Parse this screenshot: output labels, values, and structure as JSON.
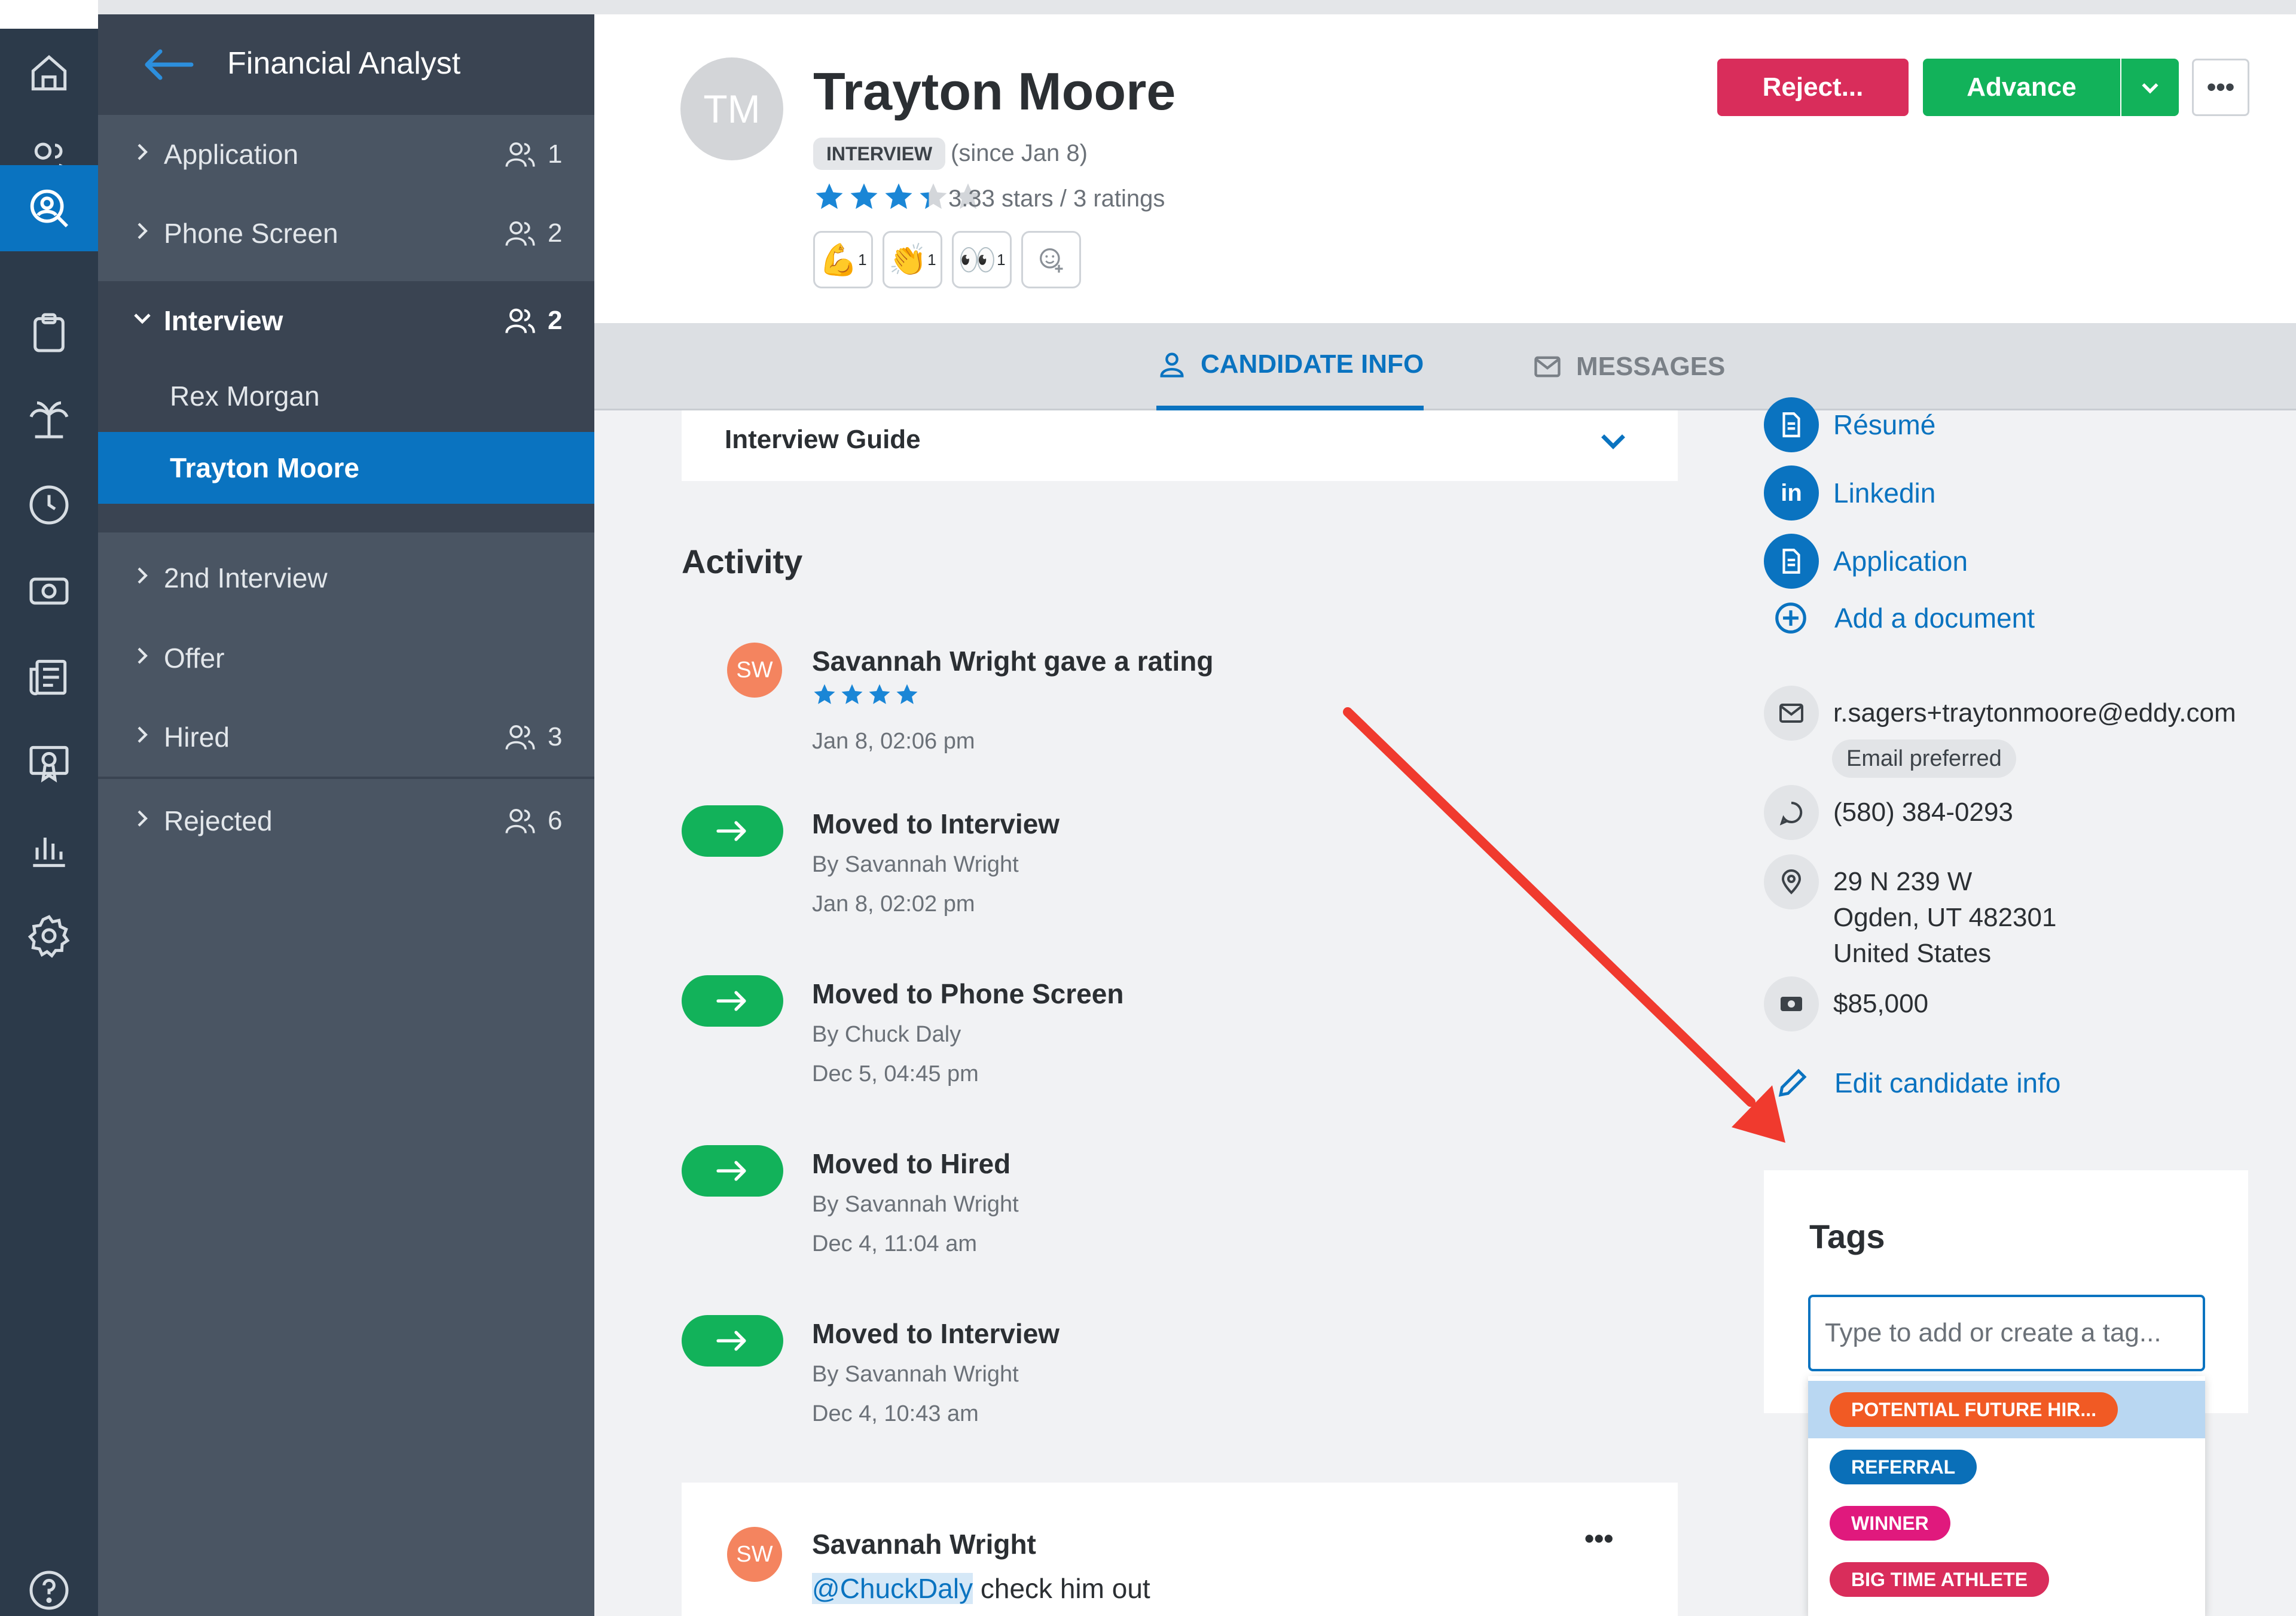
{
  "sidebar": {
    "job_title": "Financial Analyst",
    "stages": [
      {
        "label": "Application",
        "count": "1"
      },
      {
        "label": "Phone Screen",
        "count": "2"
      },
      {
        "label": "Interview",
        "count": "2"
      },
      {
        "label": "2nd Interview",
        "count": ""
      },
      {
        "label": "Offer",
        "count": ""
      },
      {
        "label": "Hired",
        "count": "3"
      },
      {
        "label": "Rejected",
        "count": "6"
      }
    ],
    "interview_candidates": [
      "Rex Morgan",
      "Trayton Moore"
    ]
  },
  "rail": {
    "icons": [
      "home-icon",
      "people-icon",
      "candidate-search-icon",
      "clipboard-icon",
      "palm-tree-icon",
      "clock-icon",
      "money-icon",
      "newspaper-icon",
      "award-icon",
      "bar-chart-icon",
      "gear-icon",
      "help-icon"
    ]
  },
  "candidate": {
    "initials": "TM",
    "name": "Trayton Moore",
    "stage_badge": "INTERVIEW",
    "since": "(since Jan 8)",
    "rating_stars": 3.33,
    "ratings_text": "3.33 stars / 3 ratings",
    "reactions": [
      {
        "emoji": "💪",
        "count": "1"
      },
      {
        "emoji": "👏",
        "count": "1"
      },
      {
        "emoji": "👀",
        "count": "1"
      },
      {
        "emoji": "☺",
        "count": ""
      }
    ]
  },
  "actions": {
    "reject": "Reject...",
    "advance": "Advance",
    "more": "•••"
  },
  "tabs": {
    "candidate_info": "CANDIDATE INFO",
    "messages": "MESSAGES"
  },
  "main": {
    "interview_guide": "Interview Guide",
    "activity_title": "Activity",
    "activities": [
      {
        "type": "rating",
        "initials": "SW",
        "title": "Savannah Wright gave a rating",
        "stars": 4,
        "when": "Jan 8, 02:06 pm"
      },
      {
        "type": "move",
        "title": "Moved to Interview",
        "by": "By Savannah Wright",
        "when": "Jan 8, 02:02 pm"
      },
      {
        "type": "move",
        "title": "Moved to Phone Screen",
        "by": "By Chuck Daly",
        "when": "Dec 5, 04:45 pm"
      },
      {
        "type": "move",
        "title": "Moved to Hired",
        "by": "By Savannah Wright",
        "when": "Dec 4, 11:04 am"
      },
      {
        "type": "move",
        "title": "Moved to Interview",
        "by": "By Savannah Wright",
        "when": "Dec 4, 10:43 am"
      }
    ],
    "comment": {
      "initials": "SW",
      "author": "Savannah Wright",
      "mention": "@ChuckDaly",
      "text": " check him out",
      "menu": "•••"
    }
  },
  "right": {
    "documents": [
      "Résumé",
      "Linkedin",
      "Application"
    ],
    "add_document": "Add a document",
    "email": "r.sagers+traytonmoore@eddy.com",
    "email_pref": "Email preferred",
    "phone": "(580) 384-0293",
    "address": [
      "29 N 239 W",
      "Ogden, UT 482301",
      "United States"
    ],
    "salary": "$85,000",
    "edit_info": "Edit candidate info",
    "tags_title": "Tags",
    "tag_placeholder": "Type to add or create a tag...",
    "tag_options": [
      {
        "label": "POTENTIAL FUTURE HIR...",
        "color": "#f15a24"
      },
      {
        "label": "REFERRAL",
        "color": "#0a6fb8"
      },
      {
        "label": "WINNER",
        "color": "#e0197d"
      },
      {
        "label": "BIG TIME ATHLETE",
        "color": "#d92d5b"
      }
    ]
  },
  "colors": {
    "brand_blue": "#0a73c0",
    "advance_green": "#12b25a",
    "reject_red": "#d92d5b",
    "annotation_arrow": "#f03a2e"
  }
}
